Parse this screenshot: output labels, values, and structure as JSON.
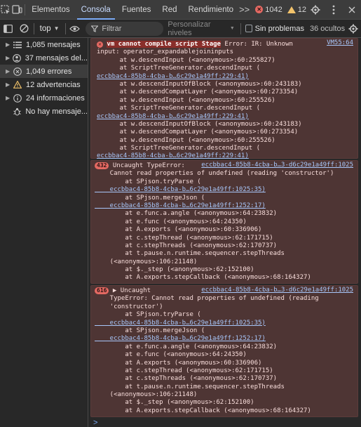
{
  "tabs": {
    "items": [
      "Elementos",
      "Consola",
      "Fuentes",
      "Red",
      "Rendimiento"
    ],
    "more": ">>",
    "error_count": "1042",
    "warning_count": "12"
  },
  "toolbar": {
    "context": "top",
    "filter_placeholder": "Filtrar",
    "levels": "Personalizar niveles",
    "no_problems": "Sin problemas",
    "hidden": "36 ocultos"
  },
  "sidebar": {
    "items": [
      {
        "label": "1,085 mensajes",
        "icon": "list-icon"
      },
      {
        "label": "37 mensajes del...",
        "icon": "user-icon"
      },
      {
        "label": "1,049 errores",
        "icon": "error-icon"
      },
      {
        "label": "12 advertencias",
        "icon": "warning-icon"
      },
      {
        "label": "24 informaciones",
        "icon": "info-icon"
      },
      {
        "label": "No hay mensaje...",
        "icon": "bug-icon"
      }
    ]
  },
  "messages": [
    {
      "source": "VM55:64",
      "head": "vm cannot compile script Stage",
      "lines": [
        " Error: IR: Unknown",
        "input: operator_expandablejoininputs",
        "      at w.descendInput (<anonymous>:60:255827)",
        "      at ScriptTreeGenerator.descendInput (",
        "eccbbac4-85b8-4cba-b…6c29e1a49ff:229:41)",
        "      at w.descendInputOfBlock (<anonymous>:60:243183)",
        "      at w.descendCompatLayer (<anonymous>:60:273354)",
        "      at w.descendInput (<anonymous>:60:255526)",
        "      at ScriptTreeGenerator.descendInput (",
        "eccbbac4-85b8-4cba-b…6c29e1a49ff:229:41)",
        "      at w.descendInputOfBlock (<anonymous>:60:243183)",
        "      at w.descendCompatLayer (<anonymous>:60:273354)",
        "      at w.descendInput (<anonymous>:60:255526)",
        "      at ScriptTreeGenerator.descendInput (",
        "eccbbac4-85b8-4cba-b…6c29e1a49ff:229:41)"
      ]
    },
    {
      "count": "432",
      "head": "Uncaught TypeError: ",
      "source": "eccbbac4-85b8-4cba-b…3-d6c29e1a49ff:1025",
      "lines": [
        "    Cannot read properties of undefined (reading 'constructor')",
        "        at SPjson.tryParse (",
        "    eccbbac4-85b8-4cba-b…6c29e1a49ff:1025:35)",
        "        at SPjson.mergeJson (",
        "    eccbbac4-85b8-4cba-b…6c29e1a49ff:1252:17)",
        "        at e.func.a.angle (<anonymous>:64:23832)",
        "        at e.func (<anonymous>:64:24350)",
        "        at A.exports (<anonymous>:60:336906)",
        "        at c.stepThread (<anonymous>:62:171715)",
        "        at c.stepThreads (<anonymous>:62:170737)",
        "        at t.pause.n.runtime.sequencer.stepThreads",
        "    (<anonymous>:106:21148)",
        "        at $._step (<anonymous>:62:152100)",
        "        at A.exports.stepCallback (<anonymous>:68:164327)"
      ]
    },
    {
      "count": "616",
      "head": "▶ Uncaught",
      "source": "eccbbac4-85b8-4cba-b…3-d6c29e1a49ff:1025",
      "lines": [
        "    TypeError: Cannot read properties of undefined (reading",
        "    'constructor')",
        "        at SPjson.tryParse (",
        "    eccbbac4-85b8-4cba-b…6c29e1a49ff:1025:35)",
        "        at SPjson.mergeJson (",
        "    eccbbac4-85b8-4cba-b…6c29e1a49ff:1252:17)",
        "        at e.func.a.angle (<anonymous>:64:23832)",
        "        at e.func (<anonymous>:64:24350)",
        "        at A.exports (<anonymous>:60:336906)",
        "        at c.stepThread (<anonymous>:62:171715)",
        "        at c.stepThreads (<anonymous>:62:170737)",
        "        at t.pause.n.runtime.sequencer.stepThreads",
        "    (<anonymous>:106:21148)",
        "        at $._step (<anonymous>:62:152100)",
        "        at A.exports.stepCallback (<anonymous>:68:164327)"
      ]
    }
  ],
  "prompt": ">"
}
